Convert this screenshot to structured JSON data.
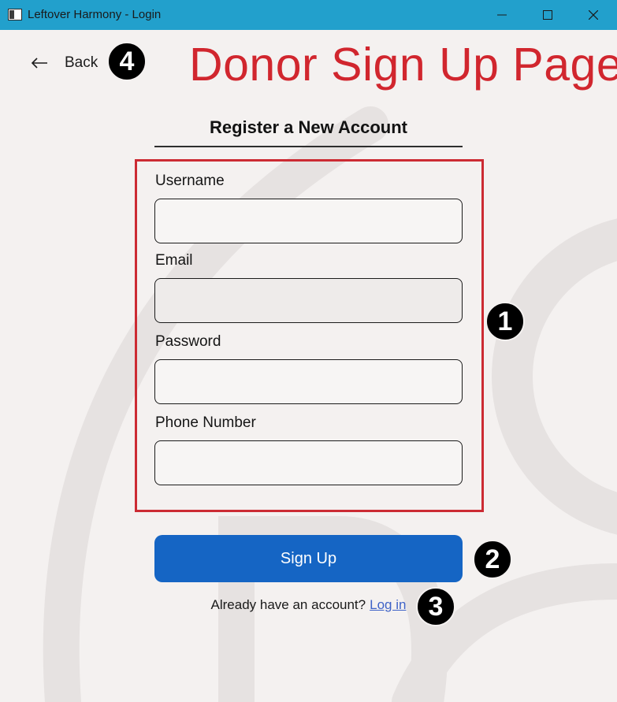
{
  "window": {
    "title": "Leftover Harmony - Login",
    "controls": [
      "minimize-icon",
      "maximize-icon",
      "close-icon"
    ]
  },
  "nav": {
    "back_label": "Back",
    "back_icon": "arrow-left-icon"
  },
  "annotation": {
    "page_title": "Donor Sign Up Page",
    "page_title_color": "#d1262e",
    "badges": [
      "1",
      "2",
      "3",
      "4"
    ]
  },
  "form": {
    "heading": "Register a New Account",
    "fields": [
      {
        "label": "Username",
        "value": "",
        "placeholder": ""
      },
      {
        "label": "Email",
        "value": "",
        "placeholder": ""
      },
      {
        "label": "Password",
        "value": "",
        "placeholder": ""
      },
      {
        "label": "Phone Number",
        "value": "",
        "placeholder": ""
      }
    ],
    "submit_label": "Sign Up",
    "submit_color": "#1565c4"
  },
  "footer": {
    "prompt": "Already have an account?",
    "link_label": "Log in"
  },
  "colors": {
    "titlebar": "#22a0cc",
    "highlight_border": "#cc2b33",
    "background": "#f4f1f0"
  }
}
